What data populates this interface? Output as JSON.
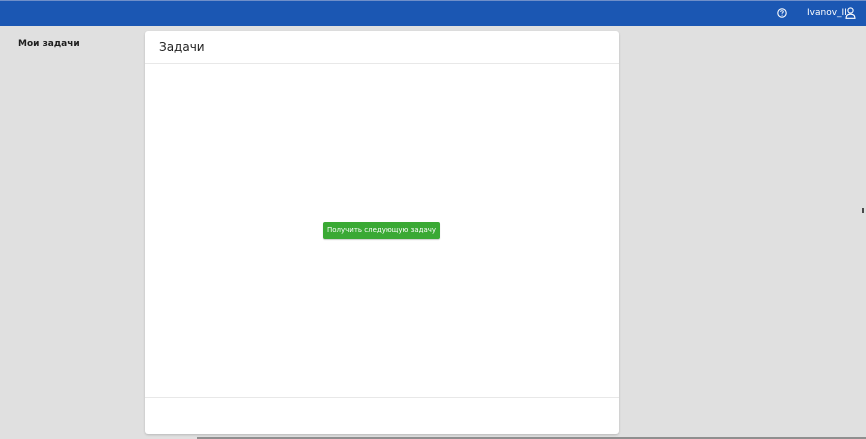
{
  "header": {
    "background_color": "#1b57b3",
    "help_icon": "question-circle-icon",
    "user_name": "Ivanov_II",
    "user_icon": "user-icon"
  },
  "sidebar": {
    "items": [
      {
        "label": "Мои задачи"
      }
    ]
  },
  "main": {
    "card_title": "Задачи",
    "next_task_button_label": "Получить следующую задачу",
    "button_color": "#3aa934"
  }
}
